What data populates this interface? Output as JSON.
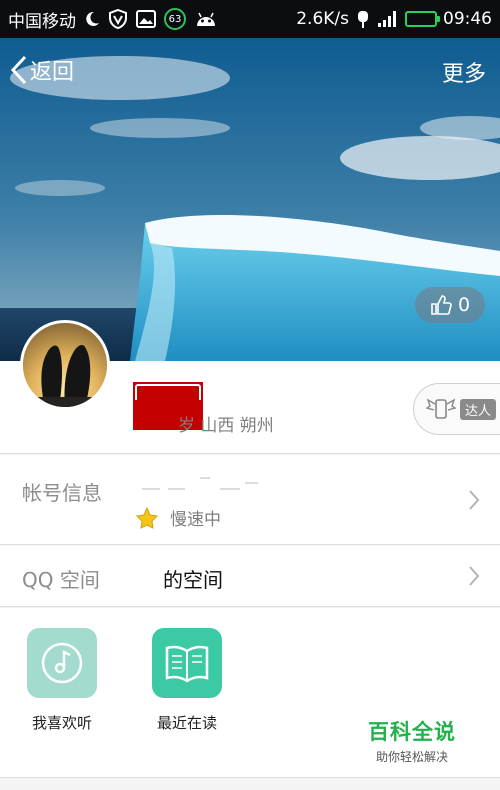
{
  "status_bar": {
    "carrier": "中国移动",
    "notification_badge": "63",
    "network_speed": "2.6K/s",
    "time": "09:46"
  },
  "header": {
    "back_label": "返回",
    "more_label": "更多"
  },
  "hero": {
    "like_count": "0"
  },
  "profile": {
    "location": "岁 山西 朔州",
    "talent_label": "达人"
  },
  "rows": {
    "account": {
      "title": "帐号信息",
      "status": "慢速中"
    },
    "qzone": {
      "title": "QQ 空间",
      "value": "的空间"
    }
  },
  "apps": [
    {
      "label": "我喜欢听",
      "icon": "music-disc-icon"
    },
    {
      "label": "最近在读",
      "icon": "book-icon"
    }
  ],
  "watermark": {
    "title": "百科全说",
    "subtitle": "助你轻松解决"
  },
  "colors": {
    "accent_green": "#21b24c",
    "music_tile": "#a3dccf",
    "read_tile": "#3ccaa4",
    "redaction": "#c40000"
  }
}
